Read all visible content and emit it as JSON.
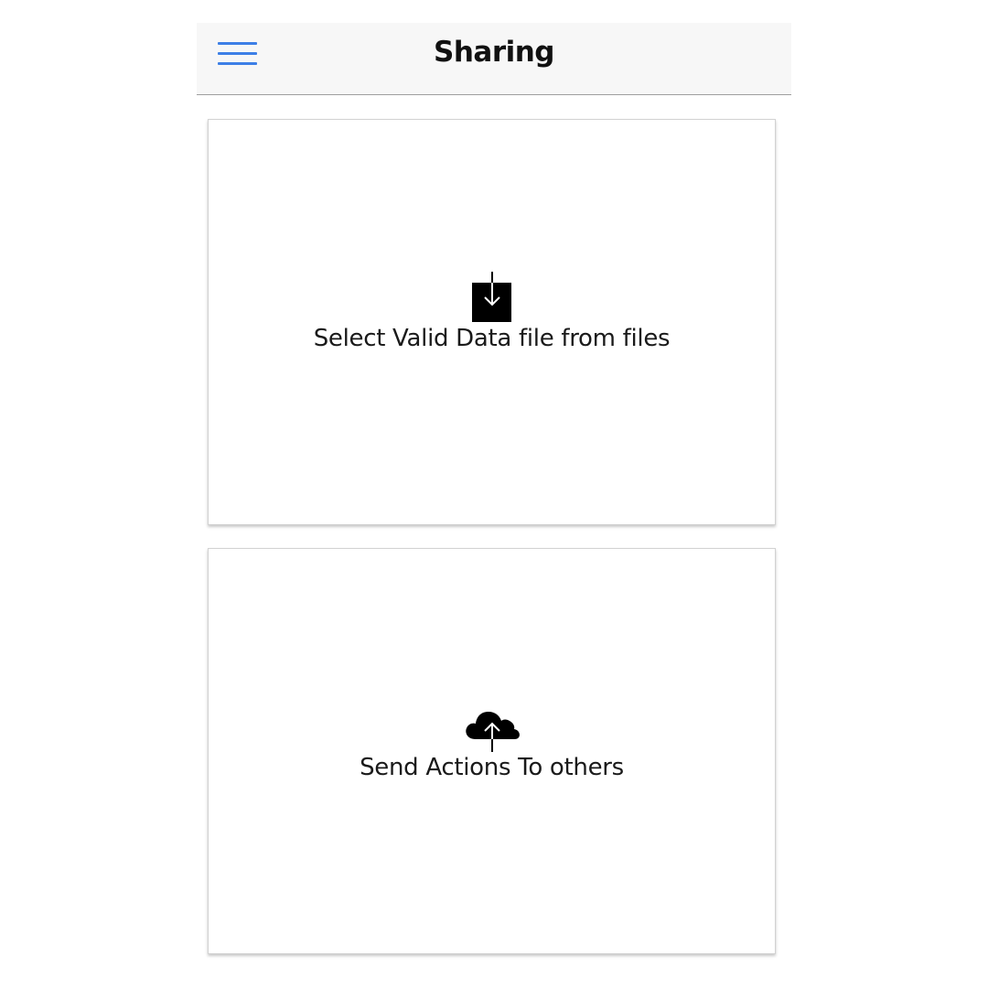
{
  "header": {
    "title": "Sharing",
    "menu_icon": "hamburger-menu-icon",
    "accent_color": "#3d7fe6"
  },
  "cards": [
    {
      "icon": "download-box-icon",
      "label": "Select Valid Data file from files"
    },
    {
      "icon": "cloud-upload-icon",
      "label": "Send Actions To others"
    }
  ]
}
